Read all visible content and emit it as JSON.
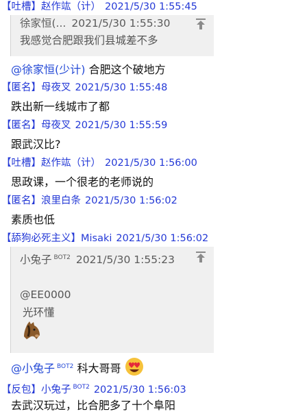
{
  "messages": [
    {
      "tag": "【吐槽】",
      "user": "赵作竑（计）",
      "time": "2021/5/30 1:55:45"
    },
    {
      "tag": "【匿名】",
      "user": "母夜叉",
      "time": "2021/5/30 1:55:48",
      "text": "跌出新一线城市了都"
    },
    {
      "tag": "【匿名】",
      "user": "母夜叉",
      "time": "2021/5/30 1:55:59",
      "text": "跟武汉比?"
    },
    {
      "tag": "【吐槽】",
      "user": "赵作竑（计）",
      "time": "2021/5/30 1:56:00",
      "text": "思政课，一个很老的老师说的"
    },
    {
      "tag": "【匿名】",
      "user": "浪里白条",
      "time": "2021/5/30 1:56:02",
      "text": "素质也低"
    },
    {
      "tag": "【舔狗必死主义】",
      "user": "Misaki",
      "time": "2021/5/30 1:56:02"
    },
    {
      "tag": "【反包】",
      "user": "小兔子",
      "bot": "BOT2",
      "time": "2021/5/30 1:56:03",
      "text": "去武汉玩过，比合肥多了十个阜阳"
    }
  ],
  "quote1": {
    "user": "徐家恒(...",
    "time": "2021/5/30 1:55:30",
    "text": "我感觉合肥跟我们县城差不多"
  },
  "reply1": {
    "mention": "@徐家恒(少计)",
    "text": " 合肥这个破地方"
  },
  "quote2": {
    "user": "小兔子",
    "bot": "BOT2",
    "time": "2021/5/30 1:55:23",
    "line1": "@EE0000",
    "line2": "光环懂"
  },
  "reply2": {
    "mention": "@小兔子",
    "bot": "BOT2",
    "text": "科大哥哥"
  },
  "icons": {
    "scroll_up": "arrow-up-to-bar-icon",
    "horse": "horse-face-emoji",
    "heart_eyes": "heart-eyes-emoji"
  }
}
